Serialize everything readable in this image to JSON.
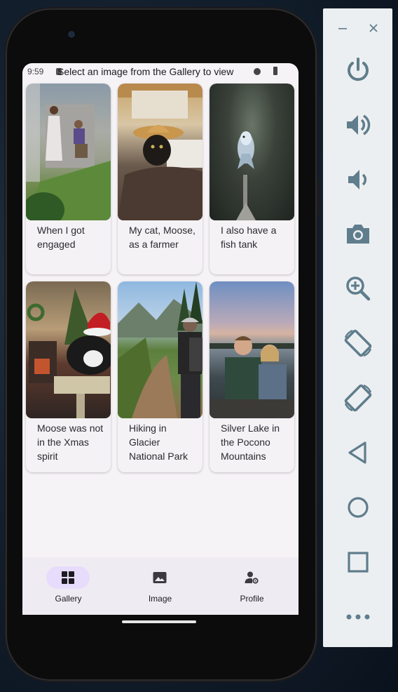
{
  "status": {
    "time": "9:59",
    "title": "Select an image from the Gallery to view"
  },
  "gallery": [
    {
      "caption": "When I got engaged",
      "photo": "engagement-photo"
    },
    {
      "caption": "My cat, Moose, as a farmer",
      "photo": "cat-farmer-photo"
    },
    {
      "caption": "I also have a fish tank",
      "photo": "fish-tank-photo"
    },
    {
      "caption": "Moose was not in the Xmas spirit",
      "photo": "cat-christmas-photo"
    },
    {
      "caption": "Hiking in Glacier National Park",
      "photo": "hiking-photo"
    },
    {
      "caption": "Silver Lake in the Pocono Mountains",
      "photo": "lake-photo"
    }
  ],
  "nav": {
    "items": [
      {
        "label": "Gallery",
        "icon": "grid-icon",
        "active": true
      },
      {
        "label": "Image",
        "icon": "image-icon",
        "active": false
      },
      {
        "label": "Profile",
        "icon": "profile-settings-icon",
        "active": false
      }
    ]
  },
  "emulator": {
    "buttons": [
      "power-icon",
      "volume-up-icon",
      "volume-down-icon",
      "camera-icon",
      "zoom-in-icon",
      "rotate-left-icon",
      "rotate-right-icon",
      "back-icon",
      "home-icon",
      "overview-icon",
      "more-icon"
    ]
  },
  "colors": {
    "accent_pill": "#e7dcfb",
    "nav_bg": "#efebf2",
    "screen_bg": "#f6f3f7",
    "panel_icon": "#5f7d8c"
  }
}
